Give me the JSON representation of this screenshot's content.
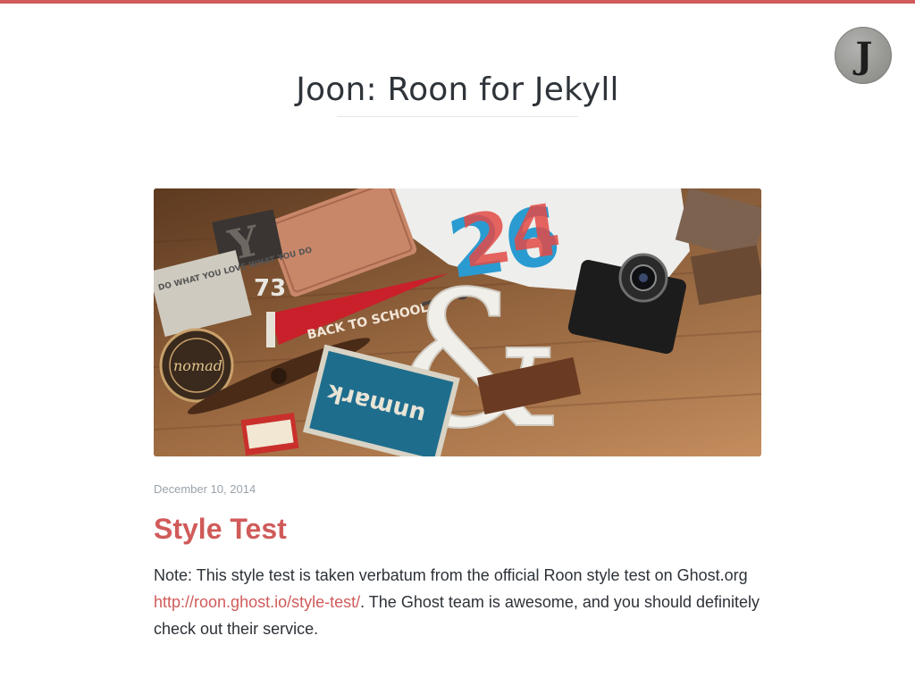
{
  "header": {
    "site_title": "Joon: Roon for Jekyll",
    "avatar_letter": "J",
    "accent_color": "#d05b5a"
  },
  "feature_image": {
    "labels": {
      "book": "DO WHAT YOU LOVE WHAT YOU DO",
      "pennant": "BACK TO SCHOOL",
      "badge": "nomad",
      "card": "unmark",
      "number": "73"
    }
  },
  "post": {
    "date": "December 10, 2014",
    "title": "Style Test",
    "excerpt_before": "Note: This style test is taken verbatum from the official Roon style test on Ghost.org ",
    "link_text": "http://roon.ghost.io/style-test/",
    "excerpt_after": ". The Ghost team is awesome, and you should definitely check out their service."
  },
  "colors": {
    "link": "#d05b5a",
    "date": "#9aa2aa",
    "text": "#2d3238"
  }
}
